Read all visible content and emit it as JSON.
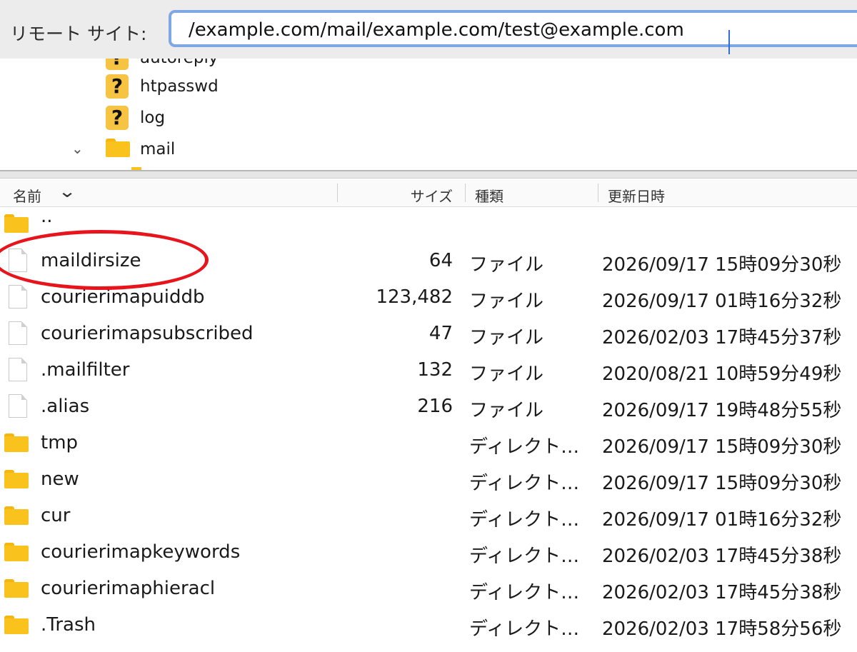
{
  "remote_site": {
    "label": "リモート サイト:",
    "path": "/example.com/mail/example.com/test@example.com"
  },
  "tree": {
    "items": [
      {
        "label": "autoreply",
        "icon": "question-icon"
      },
      {
        "label": "htpasswd",
        "icon": "question-icon"
      },
      {
        "label": "log",
        "icon": "question-icon"
      },
      {
        "label": "mail",
        "icon": "folder-icon",
        "expanded": true
      }
    ]
  },
  "list": {
    "columns": {
      "name": "名前",
      "size": "サイズ",
      "type": "種類",
      "modified": "更新日時"
    },
    "sort_icon": "chevron-down-icon",
    "rows": [
      {
        "icon": "folder-icon",
        "name": "..",
        "size": "",
        "type": "",
        "modified": ""
      },
      {
        "icon": "file-icon",
        "name": "maildirsize",
        "size": "64",
        "type": "ファイル",
        "modified": "2026/09/17 15時09分30秒"
      },
      {
        "icon": "file-icon",
        "name": "courierimapuiddb",
        "size": "123,482",
        "type": "ファイル",
        "modified": "2026/09/17 01時16分32秒"
      },
      {
        "icon": "file-icon",
        "name": "courierimapsubscribed",
        "size": "47",
        "type": "ファイル",
        "modified": "2026/02/03 17時45分37秒"
      },
      {
        "icon": "file-icon",
        "name": ".mailfilter",
        "size": "132",
        "type": "ファイル",
        "modified": "2020/08/21 10時59分49秒"
      },
      {
        "icon": "file-icon",
        "name": ".alias",
        "size": "216",
        "type": "ファイル",
        "modified": "2026/09/17 19時48分55秒"
      },
      {
        "icon": "folder-icon",
        "name": "tmp",
        "size": "",
        "type": "ディレクト…",
        "modified": "2026/09/17 15時09分30秒"
      },
      {
        "icon": "folder-icon",
        "name": "new",
        "size": "",
        "type": "ディレクト…",
        "modified": "2026/09/17 15時09分30秒"
      },
      {
        "icon": "folder-icon",
        "name": "cur",
        "size": "",
        "type": "ディレクト…",
        "modified": "2026/09/17 01時16分32秒"
      },
      {
        "icon": "folder-icon",
        "name": "courierimapkeywords",
        "size": "",
        "type": "ディレクト…",
        "modified": "2026/02/03 17時45分38秒"
      },
      {
        "icon": "folder-icon",
        "name": "courierimaphieracl",
        "size": "",
        "type": "ディレクト…",
        "modified": "2026/02/03 17時45分38秒"
      },
      {
        "icon": "folder-icon",
        "name": ".Trash",
        "size": "",
        "type": "ディレクト…",
        "modified": "2026/02/03 17時58分56秒"
      }
    ]
  },
  "colors": {
    "highlight": "#e8141c",
    "folder": "#f9c21c",
    "focus_ring": "#7ea7e3"
  }
}
